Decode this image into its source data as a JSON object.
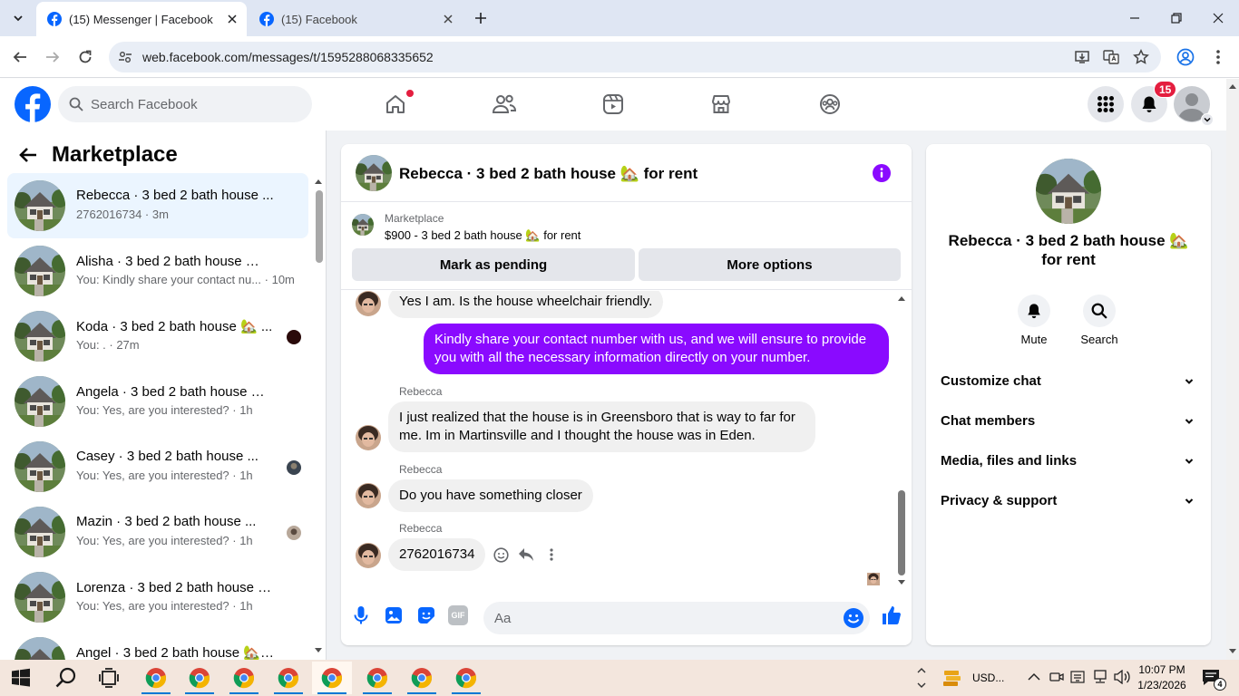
{
  "browser": {
    "tabs": [
      {
        "title": "(15) Messenger | Facebook",
        "active": true
      },
      {
        "title": "(15) Facebook",
        "active": false
      }
    ],
    "url": "web.facebook.com/messages/t/1595288068335652"
  },
  "fb_header": {
    "search_placeholder": "Search Facebook",
    "notifications_count": "15"
  },
  "left_panel": {
    "title": "Marketplace",
    "conversations": [
      {
        "name": "Rebecca · 3 bed 2 bath house ...",
        "preview": "2762016734 · 3m",
        "selected": true
      },
      {
        "name": "Alisha · 3 bed 2 bath house 🏡 f...",
        "preview": "You: Kindly share your contact nu... · 10m"
      },
      {
        "name": "Koda · 3 bed 2 bath house 🏡 ...",
        "preview": "You: . · 27m"
      },
      {
        "name": "Angela · 3 bed 2 bath house 🏡 ...",
        "preview": "You: Yes, are you interested? · 1h"
      },
      {
        "name": "Casey · 3 bed 2 bath house ...",
        "preview": "You: Yes, are you interested? · 1h"
      },
      {
        "name": "Mazin · 3 bed 2 bath house ...",
        "preview": "You: Yes, are you interested? · 1h"
      },
      {
        "name": "Lorenza · 3 bed 2 bath house 🏡 ...",
        "preview": "You: Yes, are you interested? · 1h"
      },
      {
        "name": "Angel · 3 bed 2 bath house 🏡 f...",
        "preview": ""
      }
    ]
  },
  "chat": {
    "title": "Rebecca · 3 bed 2 bath house 🏡 for rent",
    "marketplace_label": "Marketplace",
    "listing": "$900 - 3 bed 2 bath house 🏡 for rent",
    "mark_pending_label": "Mark as pending",
    "more_options_label": "More options",
    "messages": {
      "m1": "Yes I am. Is the house wheelchair friendly.",
      "m2": "Kindly share your contact number with us, and we will ensure to provide you with all the necessary information directly on your number.",
      "m3_sender": "Rebecca",
      "m3": "I just realized that the house is in Greensboro that is way to far for me. Im in Martinsville and I thought the house was in Eden.",
      "m4_sender": "Rebecca",
      "m4": "Do you have something closer",
      "m5_sender": "Rebecca",
      "m5": "2762016734"
    },
    "composer_placeholder": "Aa",
    "gif_label": "GIF",
    "accent_color": "#8a0aff"
  },
  "right_panel": {
    "name": "Rebecca · 3 bed 2 bath house 🏡 for rent",
    "mute_label": "Mute",
    "search_label": "Search",
    "sections": [
      "Customize chat",
      "Chat members",
      "Media, files and links",
      "Privacy & support"
    ]
  },
  "taskbar": {
    "currency": "USD...",
    "time": "10:07 PM",
    "date": "1/23/2026",
    "notification_count": "4"
  }
}
